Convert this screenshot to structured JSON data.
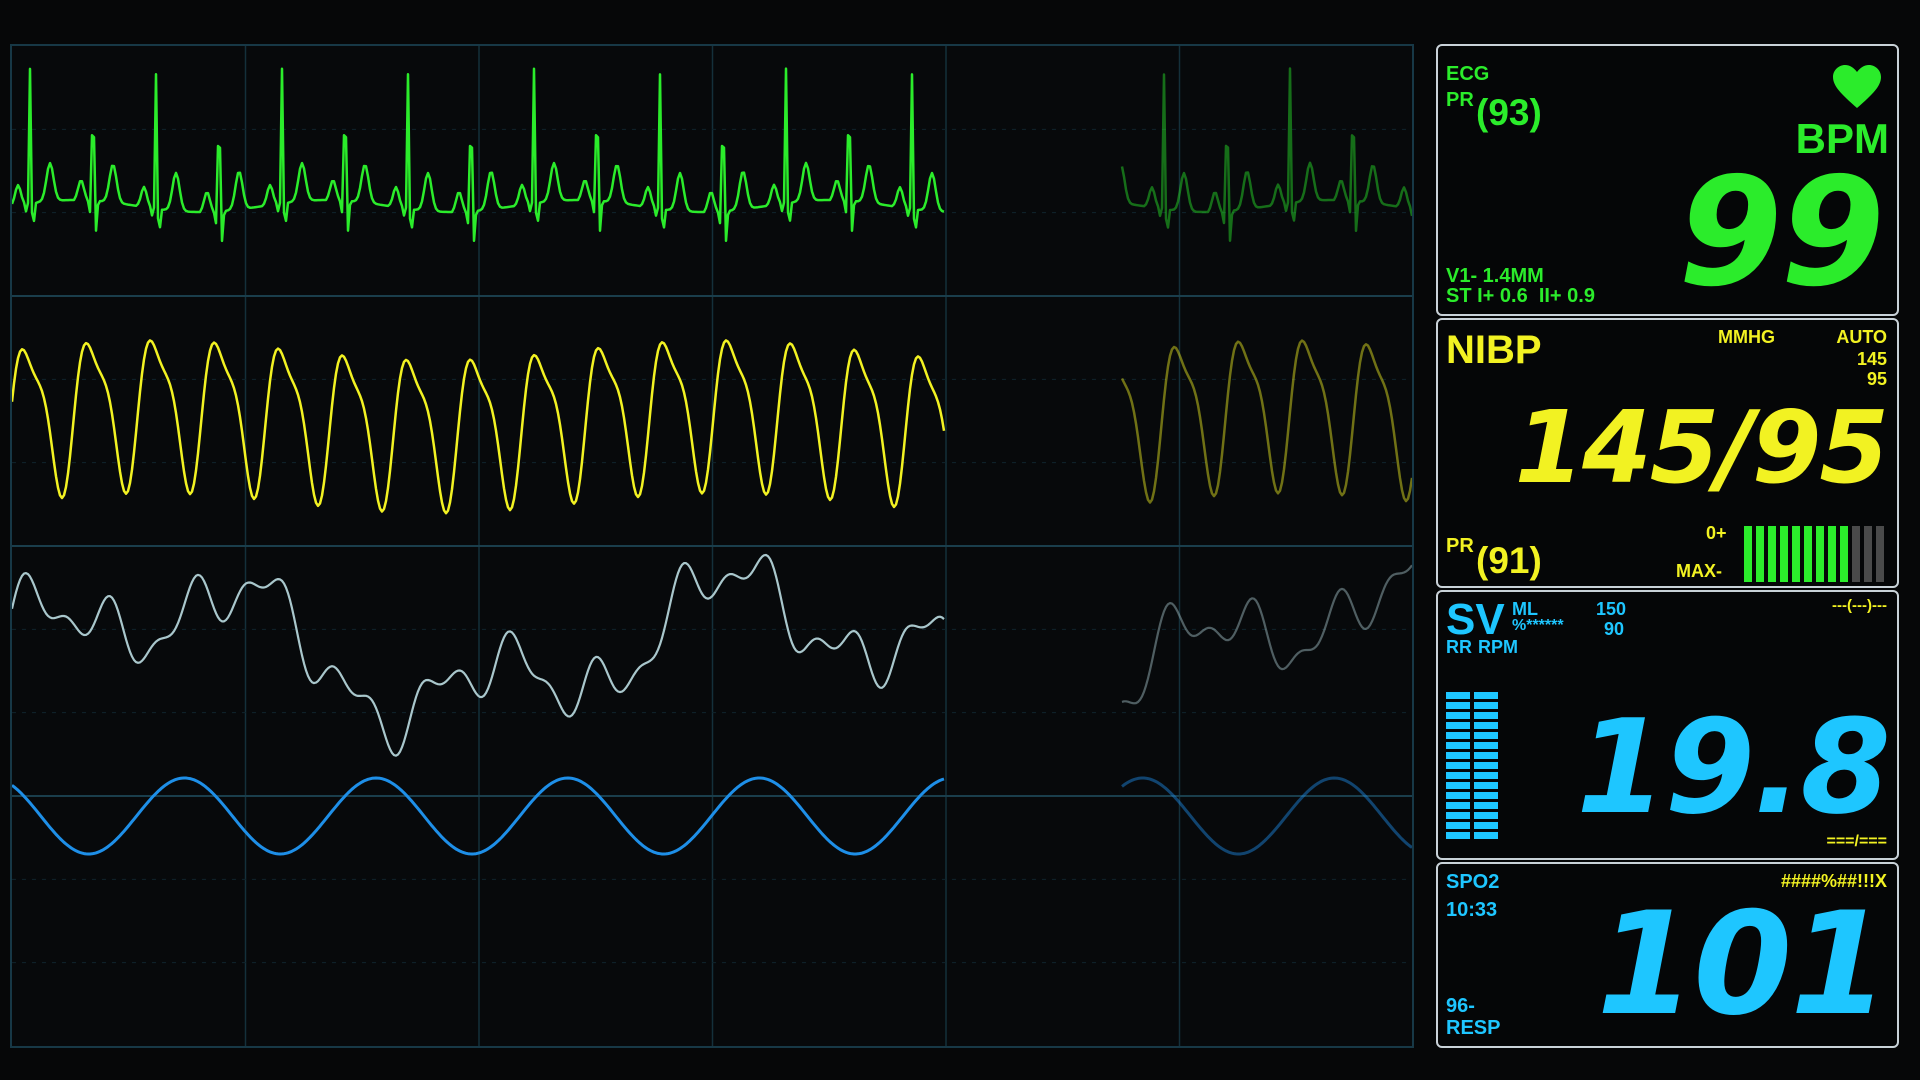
{
  "ecg": {
    "label": "ECG",
    "pr_prefix": "PR",
    "pr_value": "(93)",
    "unit": "BPM",
    "value": "99",
    "st_line1": "V1- 1.4MM",
    "st_line2": "ST I+ 0.6  II+ 0.9",
    "heart_icon": "heart-icon",
    "color": "#2bec2b"
  },
  "nibp": {
    "label": "NIBP",
    "unit": "MMHG",
    "mode": "AUTO",
    "limit_high": "145",
    "limit_low": "95",
    "value": "145/95",
    "pr_prefix": "PR",
    "pr_value": "(91)",
    "scale_top": "0+",
    "scale_bottom": "MAX-",
    "bar_level": 0.83,
    "color": "#f2f222"
  },
  "sv": {
    "label": "SV",
    "unit_ml": "ML",
    "unit_pct": "%******",
    "rr_label": "RR",
    "rpm_label": "RPM",
    "limit_high": "150",
    "limit_low": "90",
    "status": "---(---)---",
    "value": "19.8",
    "footer": "===/===",
    "bar_level": 1.0,
    "color": "#1ec6ff"
  },
  "spo2": {
    "label": "SPO2",
    "time": "10:33",
    "status": "####%##!!!X",
    "footer_1": "96-",
    "footer_2": "RESP",
    "value": "101",
    "color": "#1ec6ff"
  },
  "waveforms": {
    "colors": [
      "#2bec2b",
      "#f2f222",
      "#a9c7cc",
      "#1e8fe8"
    ]
  }
}
